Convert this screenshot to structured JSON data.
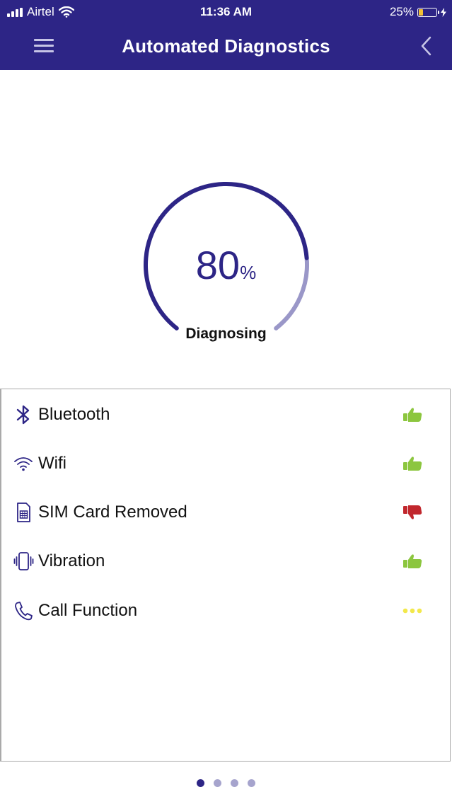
{
  "status_bar": {
    "carrier": "Airtel",
    "time": "11:36 AM",
    "battery": "25%",
    "battery_level": 0.25
  },
  "header": {
    "title": "Automated Diagnostics",
    "menu_icon": "hamburger-icon",
    "back_icon": "chevron-left-icon"
  },
  "gauge": {
    "value": "80",
    "unit": "%",
    "label": "Diagnosing",
    "progress": 0.8
  },
  "checks": [
    {
      "label": "Bluetooth",
      "icon": "bluetooth-icon",
      "status": "pass"
    },
    {
      "label": "Wifi",
      "icon": "wifi-icon",
      "status": "pass"
    },
    {
      "label": "SIM Card Removed",
      "icon": "sim-card-icon",
      "status": "fail"
    },
    {
      "label": "Vibration",
      "icon": "vibration-icon",
      "status": "pass"
    },
    {
      "label": "Call Function",
      "icon": "phone-icon",
      "status": "pending"
    }
  ],
  "colors": {
    "primary": "#2d2586",
    "pass": "#8cc63f",
    "fail": "#c1272d",
    "pending": "#f2e84b",
    "gauge_track": "#9a97c8"
  },
  "pager": {
    "pages": 4,
    "active": 0
  }
}
